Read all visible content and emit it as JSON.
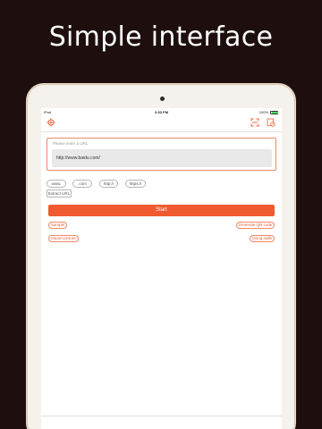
{
  "headline": "Simple interface",
  "status": {
    "carrier": "iPad",
    "time": "2:53 PM",
    "battery": "100%"
  },
  "toolbar": {
    "settings_icon": "gear-icon",
    "scan_icon": "scan-icon",
    "history_icon": "history-icon"
  },
  "url": {
    "label": "Please enter a URL",
    "value": "http://www.baidu.com/"
  },
  "chips": [
    "www.",
    ".com",
    "http://",
    "https://"
  ],
  "extract_label": "Extract URL",
  "start_label": "Start",
  "actions": {
    "sample": "Sample",
    "generate_qr": "Generate QR code",
    "import_picture": "Import picture",
    "using_skills": "Using skills"
  },
  "colors": {
    "accent": "#f05a2f",
    "background": "#1e0f0e",
    "device_frame": "#f5f1ec"
  }
}
